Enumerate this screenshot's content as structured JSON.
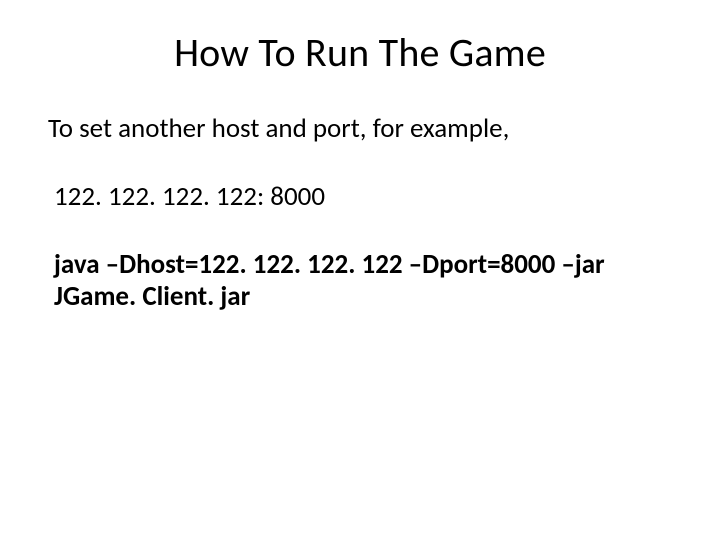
{
  "slide": {
    "title": "How To Run The Game",
    "intro": "To set another host and port, for example,",
    "example_address": "122. 122. 122. 122: 8000",
    "command": "java –Dhost=122. 122. 122. 122 –Dport=8000 –jar JGame. Client. jar"
  }
}
